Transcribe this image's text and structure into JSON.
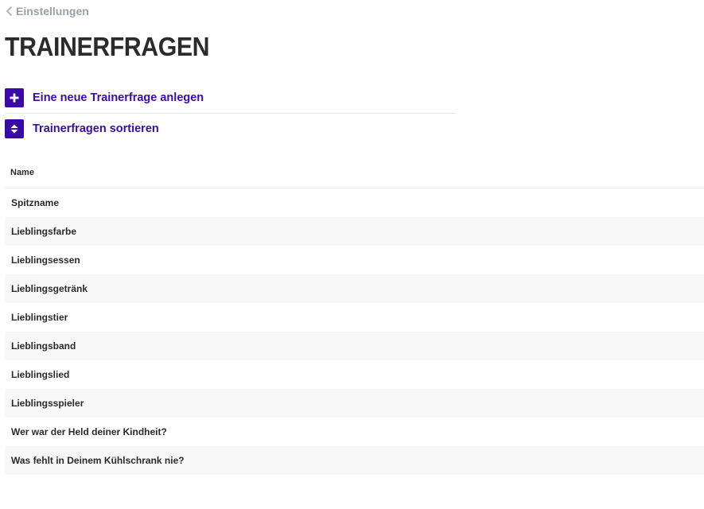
{
  "breadcrumb": {
    "label": "Einstellungen",
    "icon": "chevron-left-icon"
  },
  "page": {
    "title": "TRAINERFRAGEN"
  },
  "actions": [
    {
      "label": "Eine neue Trainerfrage anlegen",
      "icon": "plus-icon"
    },
    {
      "label": "Trainerfragen sortieren",
      "icon": "sort-icon"
    }
  ],
  "table": {
    "header": "Name",
    "rows": [
      "Spitzname",
      "Lieblingsfarbe",
      "Lieblingsessen",
      "Lieblingsgetränk",
      "Lieblingstier",
      "Lieblingsband",
      "Lieblingslied",
      "Lieblingsspieler",
      "Wer war der Held deiner Kindheit?",
      "Was fehlt in Deinem Kühlschrank nie?"
    ]
  },
  "colors": {
    "accent": "#3b0aa6",
    "muted": "#9aa0a6",
    "text": "#2b2b2b",
    "row_alt": "#f8f8f8"
  }
}
